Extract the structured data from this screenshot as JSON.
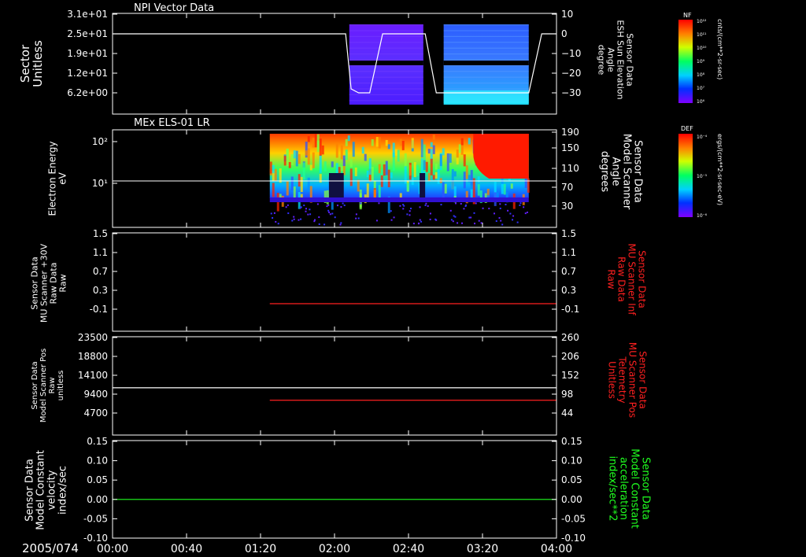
{
  "date_label": "2005/074",
  "time_axis": {
    "ticks": [
      "00:00",
      "00:40",
      "01:20",
      "02:00",
      "02:40",
      "03:20",
      "04:00"
    ]
  },
  "colors": {
    "axis": "#ffffff",
    "red_trace": "#ff2020",
    "green_trace": "#20ff20",
    "white_trace": "#ffffff"
  },
  "colorbars": [
    {
      "label": "NF",
      "unit": "cnts/(cm**2-sr-sec)",
      "ticks": [
        "10¹²",
        "10¹¹",
        "10¹⁰",
        "10⁹",
        "10⁸",
        "10⁷",
        "10⁶"
      ]
    },
    {
      "label": "DEF",
      "unit": "ergs/(cm**2-sr-sec-eV)",
      "ticks": [
        "10⁻⁴",
        "10⁻⁵",
        "10⁻⁶"
      ]
    }
  ],
  "chart_data": [
    {
      "type": "heatmap",
      "title": "NPI Vector Data",
      "ylabel": [
        "Sector",
        "Unitless"
      ],
      "yticks": [
        "3.1e+01",
        "2.5e+01",
        "1.9e+01",
        "1.2e+01",
        "6.2e+00"
      ],
      "y2label": [
        "Sensor Data",
        "ESH Sun Elevation",
        "Angle",
        "degree"
      ],
      "y2ticks": [
        "10",
        "0",
        "−10",
        "−20",
        "−30"
      ],
      "y2lim": [
        -40,
        10
      ],
      "data_intervals": [
        [
          "02:08",
          "02:48"
        ],
        [
          "02:59",
          "03:45"
        ]
      ],
      "line": {
        "name": "ESH Sun Elevation Angle",
        "x": [
          "00:00",
          "02:06",
          "02:09",
          "02:13",
          "02:19",
          "02:26",
          "02:39",
          "02:49",
          "02:55",
          "02:59",
          "03:45",
          "03:52",
          "03:58",
          "04:00"
        ],
        "y": [
          0,
          0,
          -28,
          -30,
          -30,
          0,
          0,
          0,
          -30,
          -30,
          -30,
          0,
          0,
          0
        ]
      }
    },
    {
      "type": "heatmap",
      "title": "MEx ELS-01 LR",
      "ylabel": [
        "Electron Energy",
        "eV"
      ],
      "yticks": [
        "10²",
        "10¹"
      ],
      "y2label": [
        "Sensor Data",
        "Model Scanner",
        "Angle",
        "degrees"
      ],
      "y2ticks": [
        "190",
        "150",
        "110",
        "70",
        "30"
      ],
      "y2lim": [
        0,
        190
      ],
      "data_interval": [
        "01:25",
        "03:45"
      ],
      "line": {
        "name": "Model Scanner Angle",
        "y": 90
      }
    },
    {
      "type": "line",
      "ylabel": [
        "Sensor Data",
        "MU Scanner +30V",
        "Raw Data",
        "Raw"
      ],
      "yticks": [
        "1.5",
        "1.1",
        "0.7",
        "0.3",
        "-0.1"
      ],
      "y2label": [
        "Sensor Data",
        "MU Scanner Inf",
        "Raw Data",
        "Raw"
      ],
      "y2ticks": [
        "1.5",
        "1.1",
        "0.7",
        "0.3",
        "-0.1"
      ],
      "ylim": [
        -0.3,
        1.5
      ],
      "series": [
        {
          "name": "MU Scanner Inf Raw Data",
          "color": "red",
          "x": [
            "01:25",
            "04:00"
          ],
          "y": [
            0,
            0
          ]
        }
      ]
    },
    {
      "type": "line",
      "ylabel": [
        "Sensor Data",
        "Model Scanner Pos",
        "Raw",
        "unitless"
      ],
      "yticks": [
        "23500",
        "18800",
        "14100",
        "9400",
        "4700"
      ],
      "y2label": [
        "Sensor Data",
        "MU Scanner Pos",
        "Telemetry",
        "Unitless"
      ],
      "y2ticks": [
        "260",
        "206",
        "152",
        "98",
        "44"
      ],
      "ylim": [
        0,
        23500
      ],
      "y2lim": [
        0,
        260
      ],
      "series": [
        {
          "name": "Model Scanner Pos Raw",
          "color": "white",
          "x": [
            "00:00",
            "04:00"
          ],
          "y": [
            11300,
            11300
          ]
        },
        {
          "name": "MU Scanner Pos Telemetry",
          "color": "red",
          "axis": "right",
          "x": [
            "01:25",
            "04:00"
          ],
          "y": [
            92,
            92
          ]
        }
      ]
    },
    {
      "type": "line",
      "ylabel": [
        "Sensor Data",
        "Model Constant",
        "velocity",
        "index/sec"
      ],
      "yticks": [
        "0.15",
        "0.10",
        "0.05",
        "0.00",
        "-0.05",
        "-0.10"
      ],
      "y2label": [
        "Sensor Data",
        "Model Constant",
        "acceleration",
        "index/sec**2"
      ],
      "y2ticks": [
        "0.15",
        "0.10",
        "0.05",
        "0.00",
        "-0.05",
        "-0.10"
      ],
      "ylim": [
        -0.1,
        0.15
      ],
      "series": [
        {
          "name": "Model Constant acceleration",
          "color": "green",
          "x": [
            "00:00",
            "04:00"
          ],
          "y": [
            0,
            0
          ]
        }
      ]
    }
  ]
}
